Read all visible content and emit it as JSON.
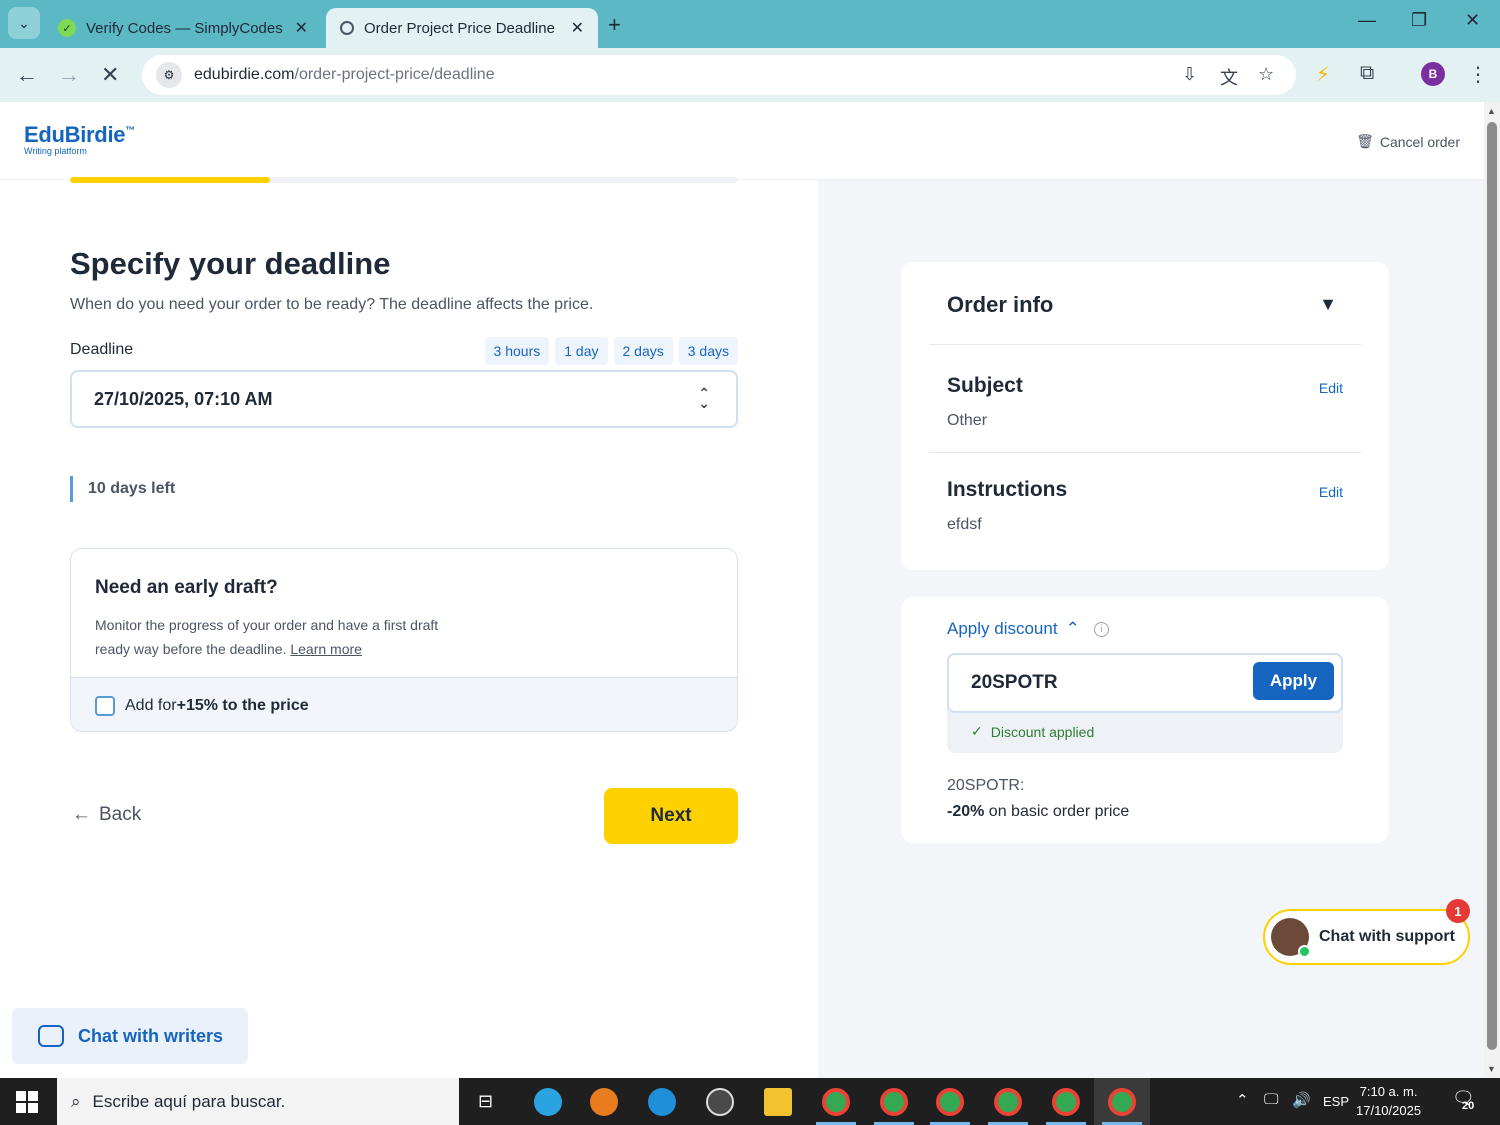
{
  "browser": {
    "tabs": [
      {
        "title": "Verify Codes — SimplyCodes",
        "active": false
      },
      {
        "title": "Order Project Price Deadline",
        "active": true
      }
    ],
    "url_domain": "edubirdie.com",
    "url_path": "/order-project-price/deadline",
    "profile_initial": "B"
  },
  "header": {
    "logo": "EduBirdie",
    "logo_tm": "™",
    "logo_tagline": "Writing platform",
    "cancel_label": "Cancel order"
  },
  "progress": {
    "fraction": 0.3
  },
  "main": {
    "title": "Specify your deadline",
    "subtitle": "When do you need your order to be ready? The deadline affects the price.",
    "deadline_label": "Deadline",
    "quick_options": [
      "3 hours",
      "1 day",
      "2 days",
      "3 days"
    ],
    "deadline_value": "27/10/2025, 07:10 AM",
    "days_left": "10 days left",
    "draft": {
      "title": "Need an early draft?",
      "desc_1": "Monitor the progress of your order and have a first draft",
      "desc_2": "ready way before the deadline.",
      "learn_more": "Learn more",
      "add_prefix": "Add for ",
      "add_bold": "+15% to the price"
    },
    "back_label": "Back",
    "next_label": "Next",
    "chat_writers": "Chat with writers"
  },
  "order_info": {
    "title": "Order info",
    "subject_title": "Subject",
    "subject_value": "Other",
    "instructions_title": "Instructions",
    "instructions_value": "efdsf",
    "edit_label": "Edit"
  },
  "discount": {
    "apply_label": "Apply discount",
    "code": "20SPOTR",
    "apply_button": "Apply",
    "status": "Discount applied",
    "promo_code_line": "20SPOTR:",
    "promo_bold": "-20%",
    "promo_rest": " on basic order price"
  },
  "support": {
    "label": "Chat with support",
    "badge": "1"
  },
  "taskbar": {
    "search_placeholder": "Escribe aquí para buscar.",
    "lang": "ESP",
    "time": "7:10 a. m.",
    "date": "17/10/2025",
    "notifications": "20"
  },
  "colors": {
    "brand_blue": "#1565c0",
    "accent_yellow": "#ffd100",
    "tab_strip": "#5bb8c4"
  }
}
